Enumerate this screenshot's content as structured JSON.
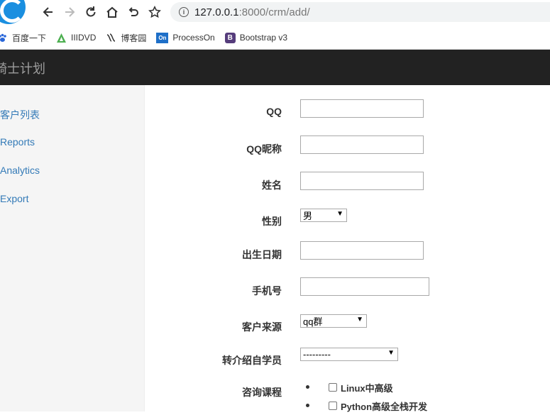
{
  "browser": {
    "url_host": "127.0.0.1",
    "url_rest": ":8000/crm/add/"
  },
  "bookmarks": [
    {
      "label": "百度一下",
      "icon": "baidu-paw-icon"
    },
    {
      "label": "IIIDVD",
      "icon": "iiidvd-icon"
    },
    {
      "label": "博客园",
      "icon": "cnblogs-icon"
    },
    {
      "label": "ProcessOn",
      "icon": "processon-icon"
    },
    {
      "label": "Bootstrap v3",
      "icon": "bootstrap-icon"
    }
  ],
  "navbar": {
    "brand": "骑士计划"
  },
  "sidebar": {
    "items": [
      {
        "label": "客户列表"
      },
      {
        "label": "Reports"
      },
      {
        "label": "Analytics"
      },
      {
        "label": "Export"
      }
    ]
  },
  "form": {
    "qq": {
      "label": "QQ",
      "value": ""
    },
    "qq_name": {
      "label": "QQ昵称",
      "value": ""
    },
    "name": {
      "label": "姓名",
      "value": ""
    },
    "sex": {
      "label": "性别",
      "selected": "男"
    },
    "birthday": {
      "label": "出生日期",
      "value": ""
    },
    "phone": {
      "label": "手机号",
      "value": ""
    },
    "source": {
      "label": "客户来源",
      "selected": "qq群"
    },
    "referral": {
      "label": "转介绍自学员",
      "selected": "---------"
    },
    "courses": {
      "label": "咨询课程",
      "options": [
        {
          "label": "Linux中高级",
          "checked": false
        },
        {
          "label": "Python高级全栈开发",
          "checked": false
        }
      ]
    }
  }
}
